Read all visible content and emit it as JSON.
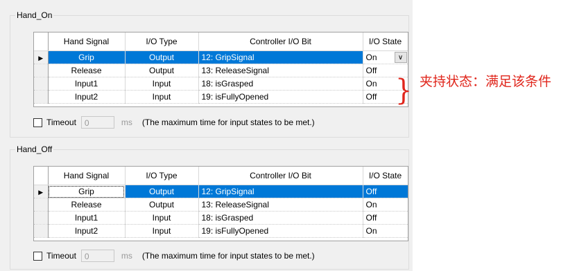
{
  "colors": {
    "selection": "#0078d7",
    "annotation": "#e0261c",
    "panel": "#f0f0f0"
  },
  "hand_on": {
    "title": "Hand_On",
    "columns": [
      "Hand Signal",
      "I/O Type",
      "Controller I/O Bit",
      "I/O State"
    ],
    "rows": [
      {
        "signal": "Grip",
        "type": "Output",
        "bit": "12: GripSignal",
        "state": "On",
        "selected": true
      },
      {
        "signal": "Release",
        "type": "Output",
        "bit": "13: ReleaseSignal",
        "state": "Off"
      },
      {
        "signal": "Input1",
        "type": "Input",
        "bit": "18: isGrasped",
        "state": "On"
      },
      {
        "signal": "Input2",
        "type": "Input",
        "bit": "19: isFullyOpened",
        "state": "Off"
      }
    ],
    "timeout_label": "Timeout",
    "timeout_value": "0",
    "ms": "ms",
    "timeout_note": "(The maximum time for input states to be met.)",
    "combo_icon": "chevron-down-icon"
  },
  "hand_off": {
    "title": "Hand_Off",
    "columns": [
      "Hand Signal",
      "I/O Type",
      "Controller I/O Bit",
      "I/O State"
    ],
    "rows": [
      {
        "signal": "Grip",
        "type": "Output",
        "bit": "12: GripSignal",
        "state": "Off",
        "selected": true
      },
      {
        "signal": "Release",
        "type": "Output",
        "bit": "13: ReleaseSignal",
        "state": "On"
      },
      {
        "signal": "Input1",
        "type": "Input",
        "bit": "18: isGrasped",
        "state": "Off"
      },
      {
        "signal": "Input2",
        "type": "Input",
        "bit": "19: isFullyOpened",
        "state": "On"
      }
    ],
    "timeout_label": "Timeout",
    "timeout_value": "0",
    "ms": "ms",
    "timeout_note": "(The maximum time for input states to be met.)"
  },
  "annotation": {
    "brace": "}",
    "text": "夹持状态：满足该条件"
  },
  "row_pointer": "▶",
  "combo_arrow": "∨"
}
